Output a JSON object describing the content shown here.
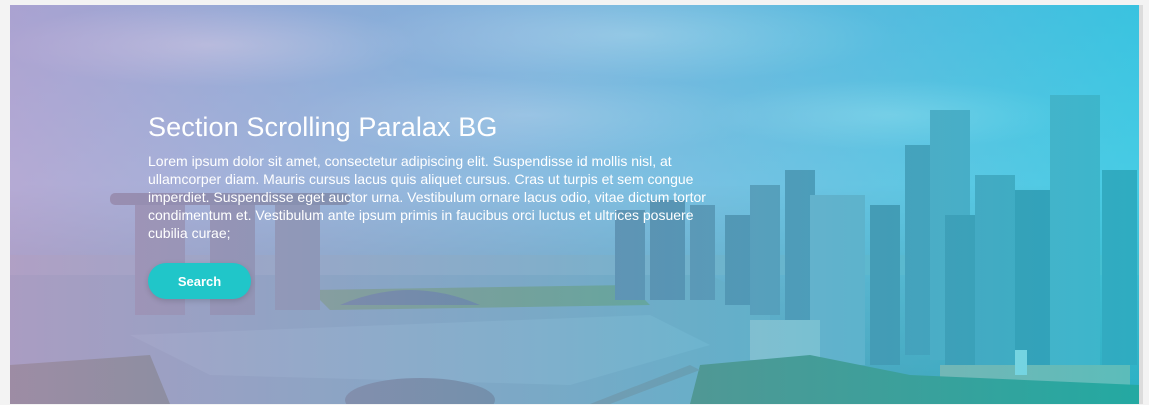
{
  "hero": {
    "title": "Section Scrolling Paralax BG",
    "description": "Lorem ipsum dolor sit amet, consectetur adipiscing elit. Suspendisse id mollis nisl, at ullamcorper diam. Mauris cursus lacus quis aliquet cursus. Cras ut turpis et sem congue imperdiet. Suspendisse eget auctor urna. Vestibulum ornare lacus odio, vitae dictum tortor condimentum et. Vestibulum ante ipsum primis in faucibus orci luctus et ultrices posuere cubilia curae;",
    "button_label": "Search"
  },
  "colors": {
    "button": "#20c6c9",
    "overlay_left": "#c496c8",
    "overlay_right": "#00cde1",
    "text": "#ffffff"
  }
}
